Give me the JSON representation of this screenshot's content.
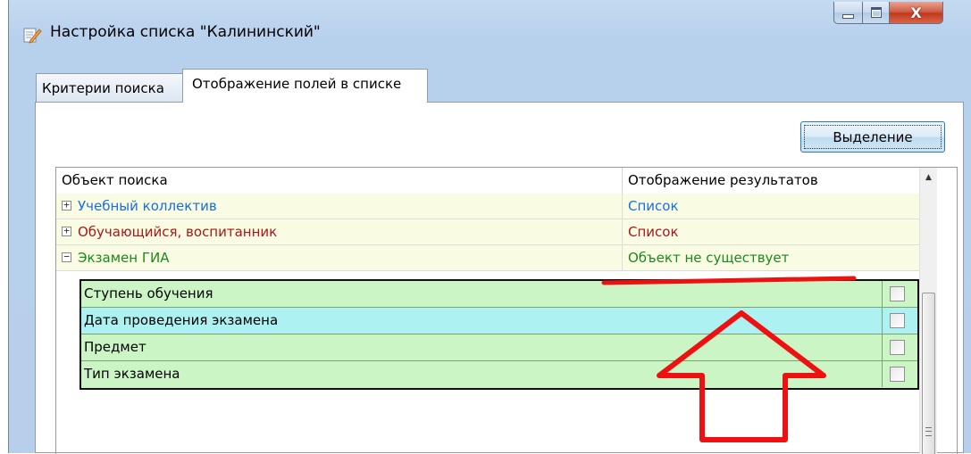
{
  "window": {
    "title": "Настройка списка  \"Калининский\"",
    "close_glyph": "X"
  },
  "tabs": [
    {
      "label": "Критерии поиска",
      "active": false
    },
    {
      "label": "Отображение полей в списке",
      "active": true
    }
  ],
  "toolbar": {
    "selection_label": "Выделение"
  },
  "grid": {
    "columns": [
      "Объект поиска",
      "Отображение результатов"
    ],
    "rows": [
      {
        "expander": "+",
        "name": "Учебный коллектив",
        "display": "Список",
        "color": "#1a6fd6"
      },
      {
        "expander": "+",
        "name": "Обучающийся, воспитанник",
        "display": "Список",
        "color": "#a8171b"
      },
      {
        "expander": "−",
        "name": "Экзамен ГИА",
        "display": "Объект не существует",
        "color": "#1c8a1c"
      }
    ],
    "subfields": [
      {
        "label": "Ступень обучения",
        "checked": false,
        "bg": "#ccf5c5"
      },
      {
        "label": "Дата проведения экзамена",
        "checked": false,
        "bg": "#aef1f3"
      },
      {
        "label": "Предмет",
        "checked": false,
        "bg": "#ccf5c5"
      },
      {
        "label": "Тип экзамена",
        "checked": false,
        "bg": "#ccf5c5"
      }
    ]
  },
  "colors": {
    "annotation": "#ee1111",
    "row_bg": "#f9fbe3"
  },
  "icons": {
    "title_icon": "edit-list-icon",
    "minimize": "minimize-icon",
    "maximize": "maximize-icon",
    "close": "close-icon",
    "scroll_up": "scroll-up-arrow-icon"
  }
}
